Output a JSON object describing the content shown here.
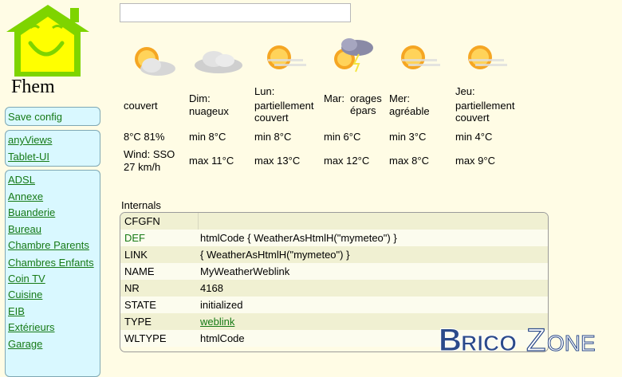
{
  "logo": {
    "text": "Fhem",
    "icon": "house-smiley-icon"
  },
  "search": {
    "value": "",
    "placeholder": ""
  },
  "menu": {
    "save_config": "Save config",
    "views": [
      "anyViews",
      "Tablet-UI"
    ],
    "rooms": [
      "ADSL",
      "Annexe",
      "Buanderie",
      "Bureau",
      "Chambre Parents",
      "Chambres Enfants",
      "Coin TV",
      "Cuisine",
      "EIB",
      "Extérieurs",
      "Garage"
    ]
  },
  "weather": {
    "current": {
      "cond": "couvert",
      "temp": "8°C 81%",
      "wind": "Wind: SSO 27 km/h",
      "icon": "cloudy-sun-icon"
    },
    "days": [
      {
        "day": "Dim:",
        "cond": "nuageux",
        "min": "min 8°C",
        "max": "max 11°C",
        "icon": "clouds-icon"
      },
      {
        "day": "Lun:",
        "cond": "partiellement couvert",
        "min": "min 8°C",
        "max": "max 13°C",
        "icon": "sun-haze-icon"
      },
      {
        "day": "Mar:",
        "cond": "orages épars",
        "min": "min 6°C",
        "max": "max 12°C",
        "icon": "storm-sun-icon"
      },
      {
        "day": "Mer:",
        "cond": "agréable",
        "min": "min 3°C",
        "max": "max 8°C",
        "icon": "sun-haze-icon"
      },
      {
        "day": "Jeu:",
        "cond": "partiellement couvert",
        "min": "min 4°C",
        "max": "max 9°C",
        "icon": "sun-haze-icon"
      }
    ]
  },
  "internals": {
    "title": "Internals",
    "rows": [
      {
        "key": "CFGFN",
        "value": ""
      },
      {
        "key": "DEF",
        "value": "htmlCode { WeatherAsHtmlH(\"mymeteo\") }"
      },
      {
        "key": "LINK",
        "value": "{ WeatherAsHtmlH(\"mymeteo\") }"
      },
      {
        "key": "NAME",
        "value": "MyWeatherWeblink"
      },
      {
        "key": "NR",
        "value": "4168"
      },
      {
        "key": "STATE",
        "value": "initialized"
      },
      {
        "key": "TYPE",
        "value": "weblink"
      },
      {
        "key": "WLTYPE",
        "value": "htmlCode"
      }
    ]
  },
  "watermark": {
    "text": "BricoZone"
  },
  "colors": {
    "background": "#fffce5",
    "menu_bg": "#d9f8ff",
    "link": "#167a16",
    "logo_green": "#7ed400",
    "logo_yellow": "#ffff00"
  }
}
